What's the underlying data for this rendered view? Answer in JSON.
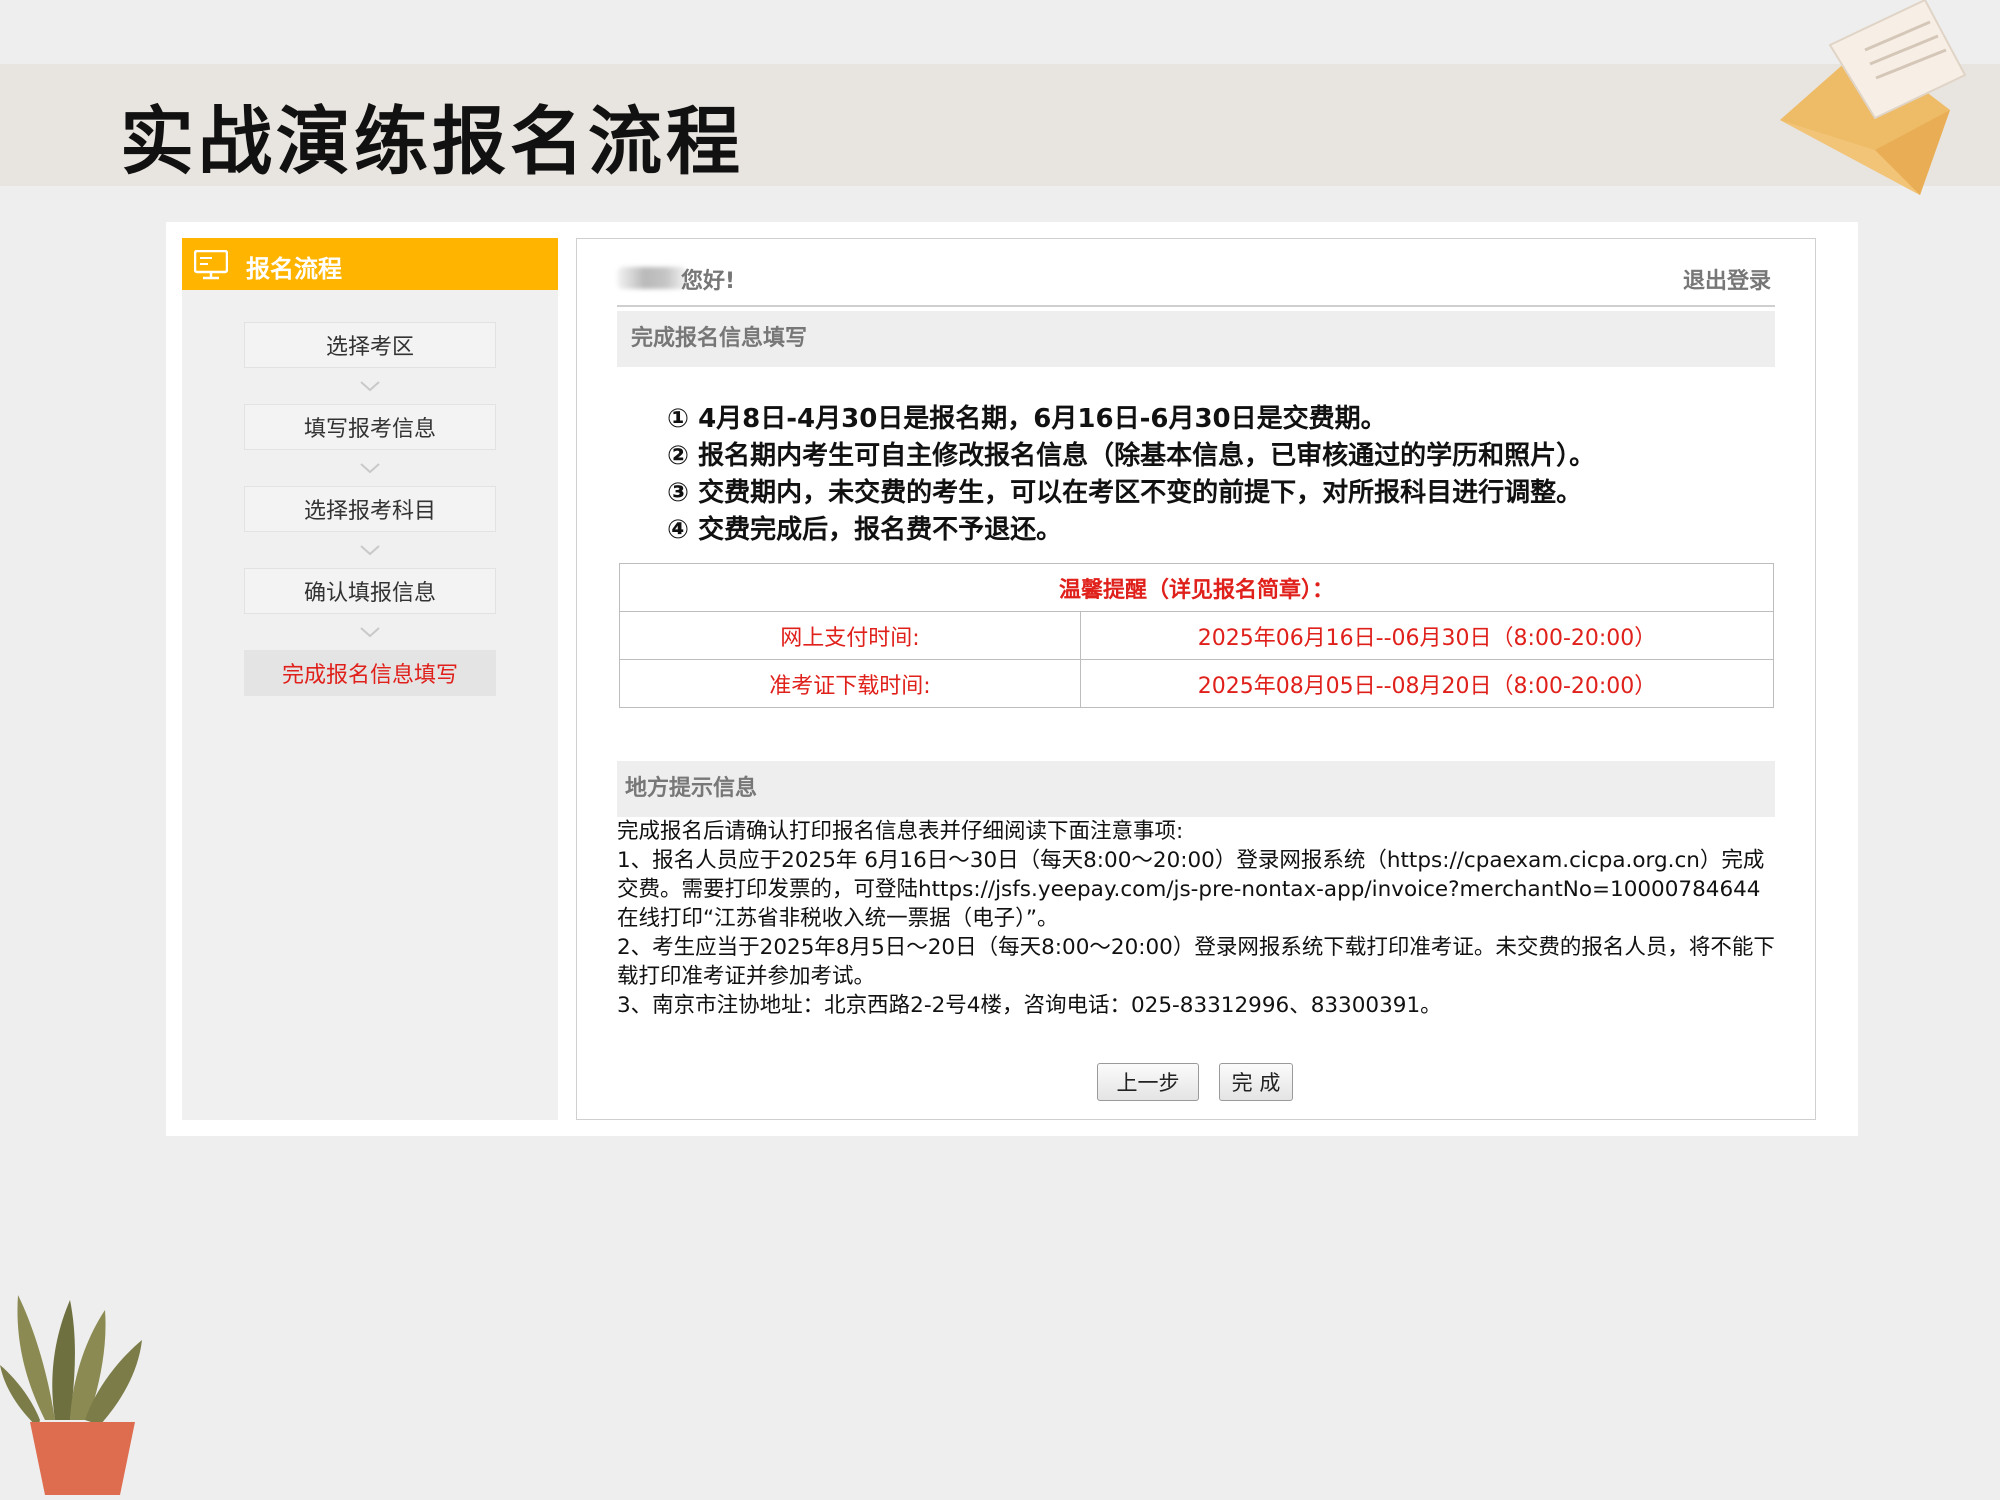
{
  "slide": {
    "title": "实战演练报名流程"
  },
  "sidebar": {
    "header": "报名流程",
    "steps": [
      {
        "label": "选择考区"
      },
      {
        "label": "填写报考信息"
      },
      {
        "label": "选择报考科目"
      },
      {
        "label": "确认填报信息"
      },
      {
        "label": "完成报名信息填写",
        "active": true
      }
    ]
  },
  "main": {
    "greeting": "您好!",
    "logout": "退出登录",
    "section_title": "完成报名信息填写",
    "notices": [
      "① 4月8日-4月30日是报名期，6月16日-6月30日是交费期。",
      "② 报名期内考生可自主修改报名信息（除基本信息，已审核通过的学历和照片）。",
      "③ 交费期内，未交费的考生，可以在考区不变的前提下，对所报科目进行调整。",
      "④ 交费完成后，报名费不予退还。"
    ],
    "tip": {
      "header": "温馨提醒（详见报名简章）：",
      "rows": [
        {
          "label": "网上支付时间:",
          "value": "2025年06月16日--06月30日（8:00-20:00）"
        },
        {
          "label": "准考证下载时间:",
          "value": "2025年08月05日--08月20日（8:00-20:00）"
        }
      ]
    },
    "local_title": "地方提示信息",
    "local_lines": [
      "完成报名后请确认打印报名信息表并仔细阅读下面注意事项:",
      "1、报名人员应于2025年 6月16日～30日（每天8:00～20:00）登录网报系统（https://cpaexam.cicpa.org.cn）完成交费。需要打印发票的，可登陆https://jsfs.yeepay.com/js-pre-nontax-app/invoice?merchantNo=10000784644在线打印“江苏省非税收入统一票据（电子）”。",
      "2、考生应当于2025年8月5日～20日（每天8:00～20:00）登录网报系统下载打印准考证。未交费的报名人员，将不能下载打印准考证并参加考试。",
      "3、南京市注协地址：北京西路2-2号4楼，咨询电话：025-83312996、83300391。"
    ],
    "buttons": {
      "prev": "上一步",
      "finish": "完 成"
    }
  },
  "colors": {
    "accent": "#ffb400",
    "alert_red": "#e0201b",
    "section_gray": "#eeeeee"
  },
  "icons": {
    "sidebar_header": "monitor-icon",
    "step_separator": "chevron-down-icon"
  }
}
